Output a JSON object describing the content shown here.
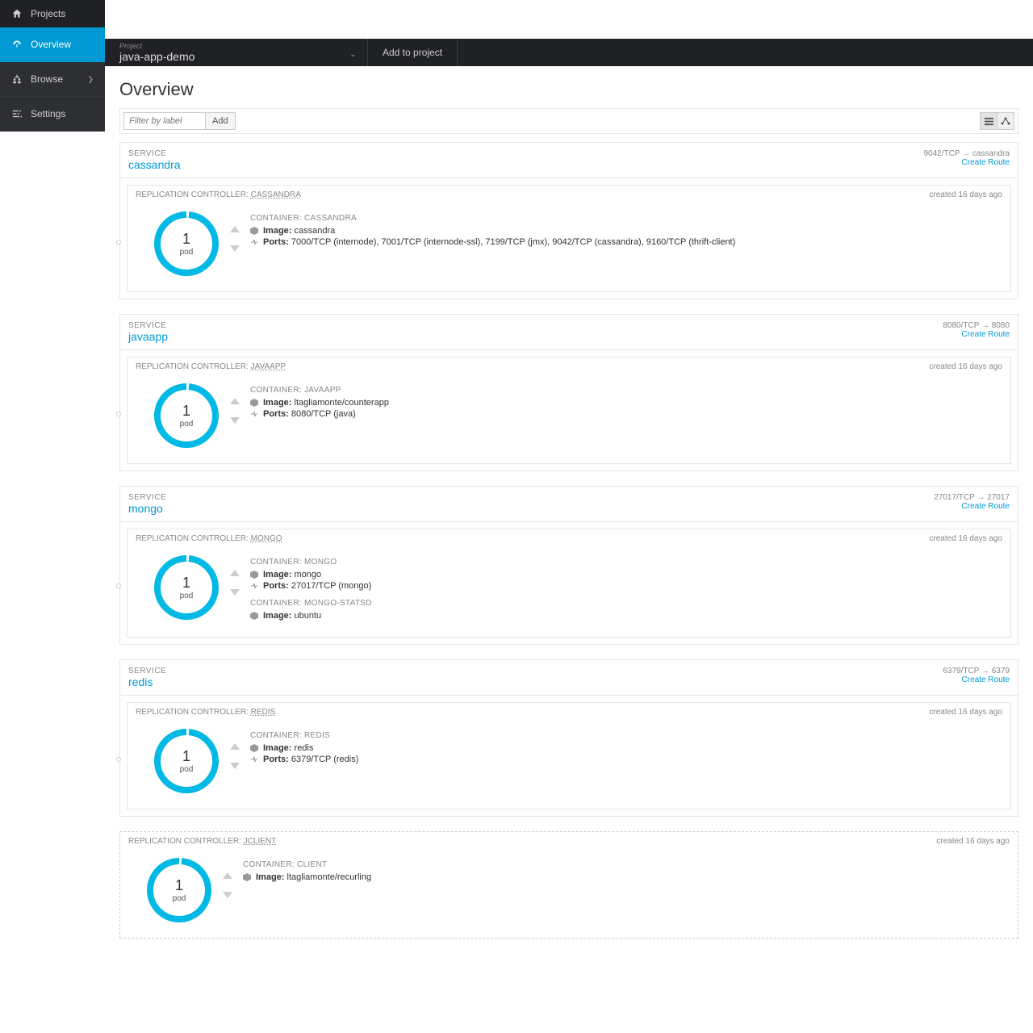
{
  "sidebar": {
    "items": [
      {
        "label": "Projects",
        "active": false,
        "has_chev": false
      },
      {
        "label": "Overview",
        "active": true,
        "has_chev": false
      },
      {
        "label": "Browse",
        "active": false,
        "has_chev": true
      },
      {
        "label": "Settings",
        "active": false,
        "has_chev": false
      }
    ]
  },
  "topbar": {
    "project_label": "Project",
    "project_name": "java-app-demo",
    "add_link": "Add to project"
  },
  "page": {
    "title": "Overview",
    "filter_placeholder": "Filter by label",
    "add_button": "Add",
    "service_label": "SERVICE",
    "rc_prefix": "REPLICATION CONTROLLER:",
    "container_prefix": "CONTAINER:",
    "image_label": "Image:",
    "ports_label": "Ports:",
    "create_route": "Create Route",
    "pod_label": "pod"
  },
  "tiles": [
    {
      "service": "cassandra",
      "port_map": "9042/TCP → cassandra",
      "rc": {
        "name": "CASSANDRA",
        "created": "created 16 days ago",
        "count": "1",
        "containers": [
          {
            "name": "CASSANDRA",
            "image": "cassandra",
            "ports": "7000/TCP (internode), 7001/TCP (internode-ssl), 7199/TCP (jmx), 9042/TCP (cassandra), 9160/TCP (thrift-client)"
          }
        ]
      }
    },
    {
      "service": "javaapp",
      "port_map": "8080/TCP → 8080",
      "rc": {
        "name": "JAVAAPP",
        "created": "created 16 days ago",
        "count": "1",
        "containers": [
          {
            "name": "JAVAAPP",
            "image": "ltagliamonte/counterapp",
            "ports": "8080/TCP (java)"
          }
        ]
      }
    },
    {
      "service": "mongo",
      "port_map": "27017/TCP → 27017",
      "rc": {
        "name": "MONGO",
        "created": "created 16 days ago",
        "count": "1",
        "containers": [
          {
            "name": "MONGO",
            "image": "mongo",
            "ports": "27017/TCP (mongo)"
          },
          {
            "name": "MONGO-STATSD",
            "image": "ubuntu"
          }
        ]
      }
    },
    {
      "service": "redis",
      "port_map": "6379/TCP → 6379",
      "rc": {
        "name": "REDIS",
        "created": "created 16 days ago",
        "count": "1",
        "containers": [
          {
            "name": "REDIS",
            "image": "redis",
            "ports": "6379/TCP (redis)"
          }
        ]
      }
    }
  ],
  "standalone_rc": {
    "name": "JCLIENT",
    "created": "created 16 days ago",
    "count": "1",
    "containers": [
      {
        "name": "CLIENT",
        "image": "ltagliamonte/recurling"
      }
    ]
  }
}
